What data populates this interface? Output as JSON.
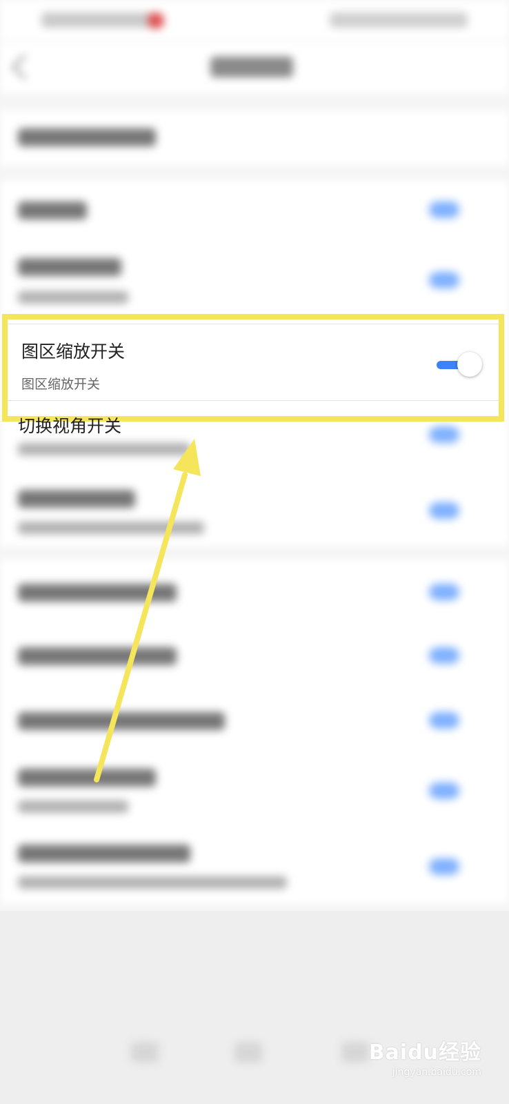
{
  "highlighted_setting": {
    "title": "图区缩放开关",
    "subtitle": "图区缩放开关",
    "toggle_on": true
  },
  "next_setting": {
    "title": "切换视角开关"
  },
  "watermark": {
    "brand": "Baidu经验",
    "url": "jingyan.baidu.com"
  },
  "colors": {
    "highlight": "#f5e55a",
    "toggle_active": "#3b82f6"
  }
}
